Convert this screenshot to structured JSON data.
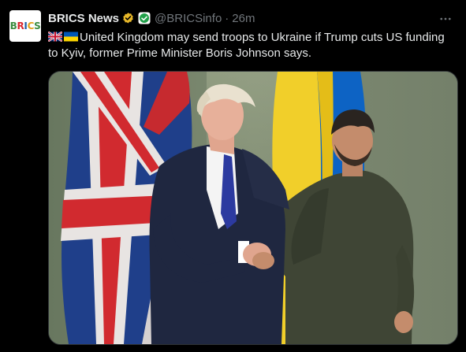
{
  "author": {
    "name": "BRICS News",
    "handle": "@BRICSinfo",
    "separator": "·",
    "time": "26m",
    "avatar_text": [
      "B",
      "R",
      "I",
      "C",
      "S"
    ],
    "avatar_colors": [
      "#3a8c3f",
      "#d9272e",
      "#1f5fa8",
      "#e0a21a",
      "#3a8c3f"
    ]
  },
  "post": {
    "flags": [
      "uk-flag-icon",
      "ukraine-flag-icon"
    ],
    "text": "United Kingdom may send troops to Ukraine if Trump cuts US funding to Kyiv, former Prime Minister Boris Johnson says."
  },
  "icons": {
    "verified": "gold-verified-badge-icon",
    "affiliation": "affiliation-badge-icon",
    "more": "more-options-icon"
  },
  "colors": {
    "background": "#000000",
    "text": "#e7e9ea",
    "secondary": "#71767b",
    "verified_gold": "#e8b829",
    "affiliation_green": "#22a04a"
  },
  "more_label": "···"
}
